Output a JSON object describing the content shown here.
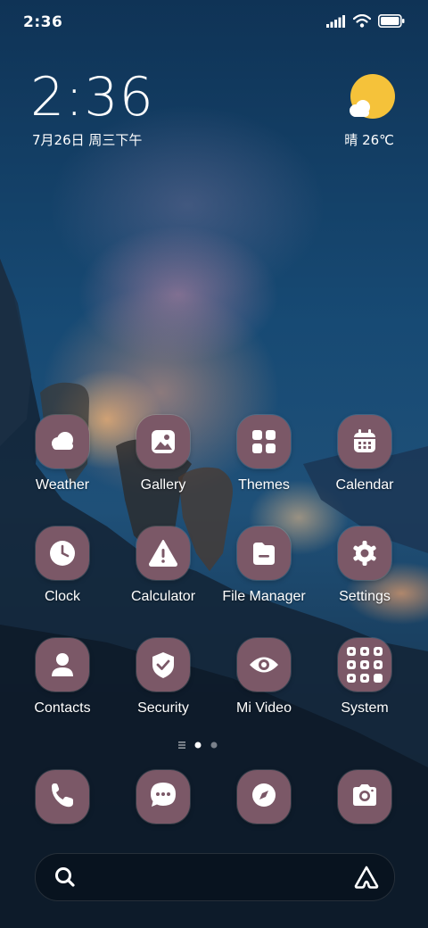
{
  "status_bar": {
    "time": "2:36",
    "icons": [
      "signal-icon",
      "wifi-icon",
      "battery-icon"
    ]
  },
  "clock_widget": {
    "time": "2:36",
    "date": "7月26日 周三下午"
  },
  "weather_widget": {
    "icon": "sun-cloud-icon",
    "condition_temp": "晴 26℃"
  },
  "apps": [
    {
      "label": "Weather",
      "icon": "cloud-icon"
    },
    {
      "label": "Gallery",
      "icon": "image-icon"
    },
    {
      "label": "Themes",
      "icon": "grid-icon"
    },
    {
      "label": "Calendar",
      "icon": "calendar-icon"
    },
    {
      "label": "Clock",
      "icon": "clock-icon"
    },
    {
      "label": "Calculator",
      "icon": "warning-icon"
    },
    {
      "label": "File Manager",
      "icon": "folder-icon"
    },
    {
      "label": "Settings",
      "icon": "gear-icon"
    },
    {
      "label": "Contacts",
      "icon": "person-icon"
    },
    {
      "label": "Security",
      "icon": "shield-check-icon"
    },
    {
      "label": "Mi Video",
      "icon": "eye-icon"
    },
    {
      "label": "System",
      "icon": "folder-grid-icon"
    }
  ],
  "page_indicator": {
    "pages": 2,
    "current": 1
  },
  "dock": [
    {
      "icon": "phone-icon"
    },
    {
      "icon": "message-icon"
    },
    {
      "icon": "compass-icon"
    },
    {
      "icon": "camera-icon"
    }
  ],
  "search_bar": {
    "left_icon": "search-icon",
    "right_icon": "assistant-icon"
  },
  "colors": {
    "icon_background": "#7b5867",
    "wallpaper_sky": "#174a74",
    "sun": "#f5c23a"
  }
}
